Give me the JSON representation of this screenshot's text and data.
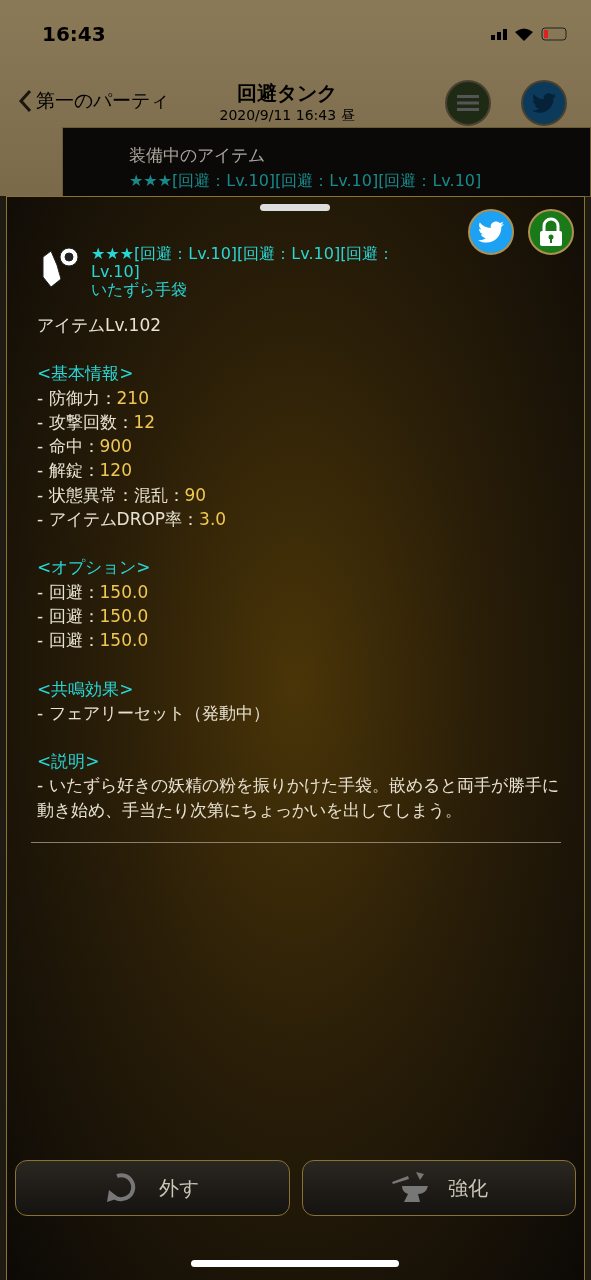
{
  "status_bar": {
    "time": "16:43"
  },
  "nav": {
    "back": "第一のパーティ",
    "title": "回避タンク",
    "subtitle": "2020/9/11 16:43 昼"
  },
  "equipped_card": {
    "heading": "装備中のアイテム",
    "options": "★★★[回避：Lv.10][回避：Lv.10][回避：Lv.10]"
  },
  "item": {
    "options": "★★★[回避：Lv.10][回避：Lv.10][回避：Lv.10]",
    "name": "いたずら手袋",
    "level": "アイテムLv.102",
    "locked": true
  },
  "sections": [
    {
      "title": "<基本情報>",
      "lines": [
        {
          "label": "-  防御力：",
          "value": "210"
        },
        {
          "label": "-  攻撃回数：",
          "value": "12"
        },
        {
          "label": "-  命中：",
          "value": "900"
        },
        {
          "label": "-  解錠：",
          "value": "120"
        },
        {
          "label": "-  状態異常：混乱：",
          "value": "90"
        },
        {
          "label": "-  アイテムDROP率：",
          "value": "3.0"
        }
      ]
    },
    {
      "title": "<オプション>",
      "lines": [
        {
          "label": "-  回避：",
          "value": "150.0"
        },
        {
          "label": "-  回避：",
          "value": "150.0"
        },
        {
          "label": "-  回避：",
          "value": "150.0"
        }
      ]
    },
    {
      "title": "<共鳴効果>",
      "lines": [
        {
          "label": "-  フェアリーセット（発動中）"
        }
      ]
    },
    {
      "title": "<説明>",
      "lines": [
        {
          "label": "-  いたずら好きの妖精の粉を振りかけた手袋。嵌めると両手が勝手に動き始め、手当たり次第にちょっかいを出してしまう。"
        }
      ]
    }
  ],
  "buttons": [
    {
      "label": "外す",
      "kind": "undo"
    },
    {
      "label": "強化",
      "kind": "anvil"
    }
  ]
}
